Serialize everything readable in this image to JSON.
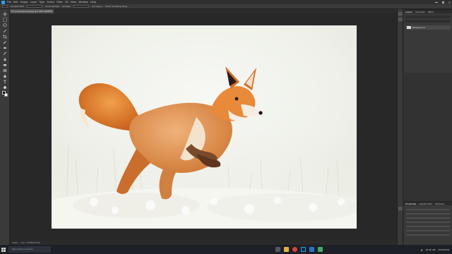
{
  "app": {
    "menu": [
      "File",
      "Edit",
      "Image",
      "Layer",
      "Type",
      "Select",
      "Filter",
      "3D",
      "View",
      "Window",
      "Help"
    ]
  },
  "options": {
    "items": [
      "Sample Size:",
      "Point Sample",
      "Sample:",
      "All Layers",
      "Show Sampling Ring"
    ]
  },
  "document": {
    "tab_label": "fox-jumping-snow.jpg @ 100% (RGB/8)"
  },
  "status": {
    "zoom": "100%",
    "doc_info": "Doc: 3.52M/3.52M"
  },
  "panels": {
    "top_tabs": [
      "Layers",
      "Channels",
      "Paths"
    ],
    "layer_name": "Background",
    "bottom_tabs": [
      "Properties",
      "Adjustments",
      "Libraries"
    ]
  },
  "taskbar": {
    "search_placeholder": "Type here to search",
    "time": "10:42 AM",
    "date": "5/14/2019"
  },
  "colors": {
    "accent": "#2ca0f0",
    "fox_orange": "#e0771f",
    "snow": "#f1f1ec"
  }
}
